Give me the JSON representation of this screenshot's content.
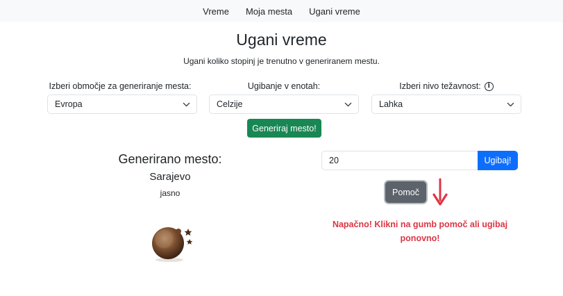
{
  "nav": {
    "items": [
      "Vreme",
      "Moja mesta",
      "Ugani vreme"
    ]
  },
  "page": {
    "title": "Ugani vreme",
    "subtitle": "Ugani koliko stopinj je trenutno v generiranem mestu."
  },
  "controls": {
    "region": {
      "label": "Izberi območje za generiranje mesta:",
      "value": "Evropa"
    },
    "units": {
      "label": "Ugibanje v enotah:",
      "value": "Celzije"
    },
    "difficulty": {
      "label": "Izberi nivo težavnost:",
      "value": "Lahka",
      "info_icon": "i"
    },
    "generate_label": "Generiraj mesto!"
  },
  "generated": {
    "heading": "Generirano mesto:",
    "city": "Sarajevo",
    "description": "jasno",
    "weather_icon": "moon-stars-icon"
  },
  "guess": {
    "input_value": "20",
    "submit_label": "Ugibaj!",
    "help_label": "Pomoč",
    "message": "Napačno! Klikni na gumb pomoč ali ugibaj ponovno!"
  },
  "colors": {
    "generate_button": "#198754",
    "guess_button": "#0d6efd",
    "help_button": "#5c636a",
    "error_text": "#dc3545",
    "arrow": "#dc3545"
  }
}
